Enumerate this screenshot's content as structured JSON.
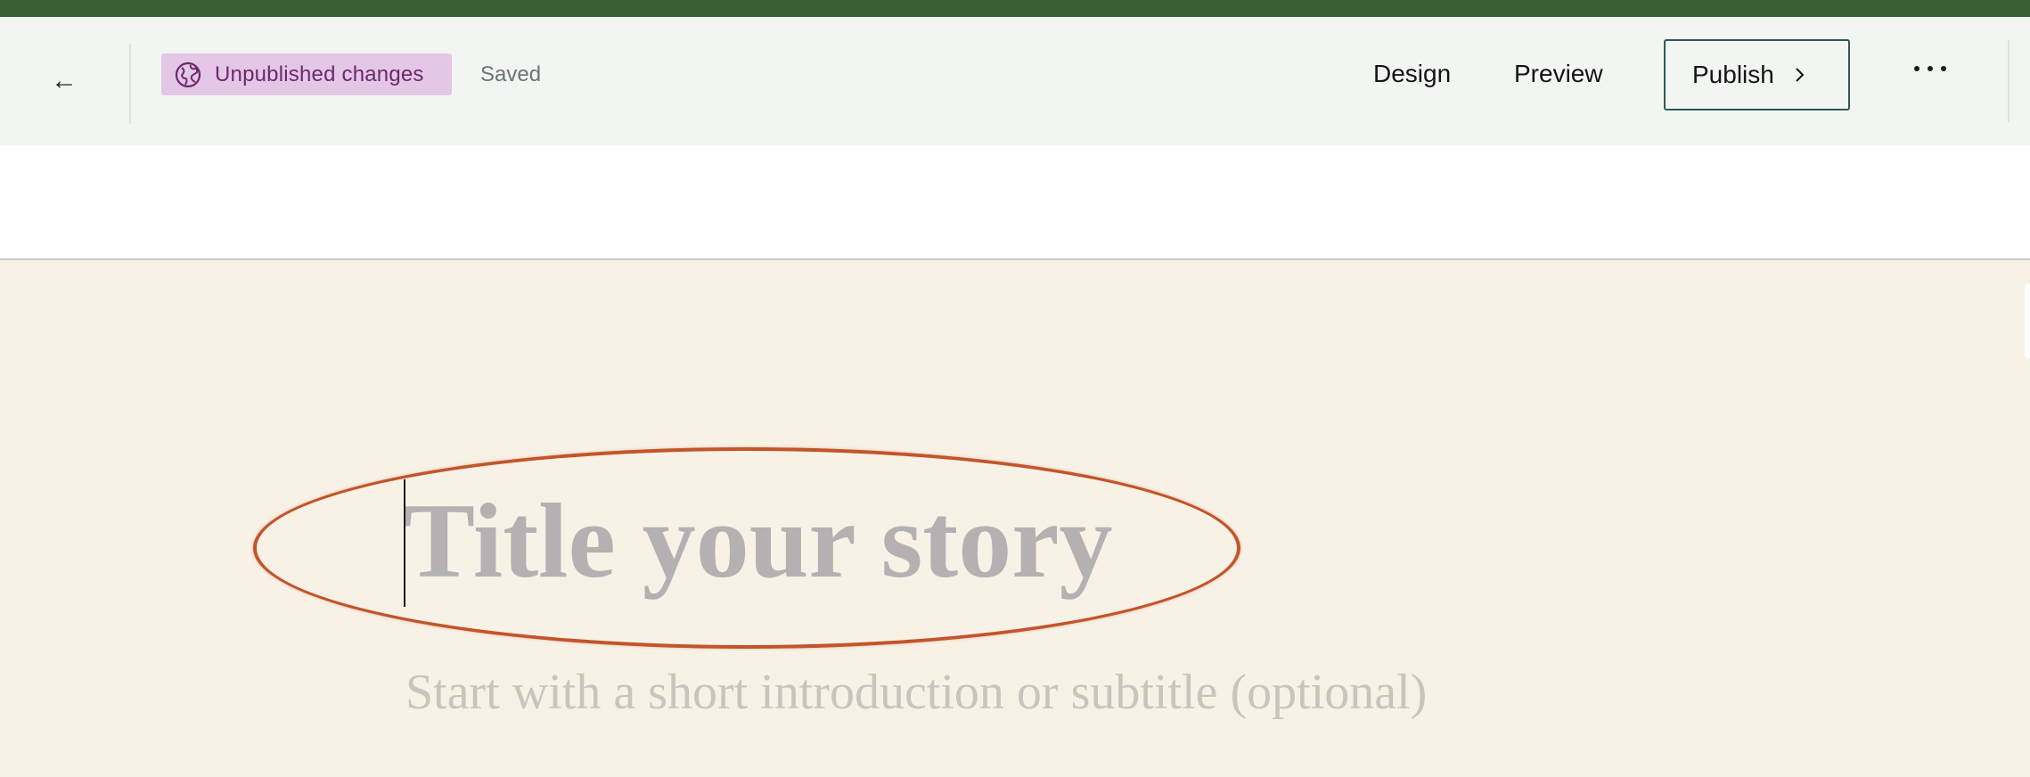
{
  "header": {
    "back_icon": "arrow-left-icon",
    "status_badge": {
      "icon": "globe-icon",
      "label": "Unpublished changes"
    },
    "save_status": "Saved",
    "nav": [
      {
        "label": "Design"
      },
      {
        "label": "Preview"
      }
    ],
    "publish_label": "Publish",
    "more_icon": "more-horizontal-icon"
  },
  "editor": {
    "title_placeholder": "Title your story",
    "subtitle_placeholder": "Start with a short introduction or subtitle (optional)"
  },
  "colors": {
    "top_strip": "#3a5f35",
    "canvas_bg": "#f8f1e6",
    "badge_bg": "#e4c6e6",
    "badge_text": "#6a2a6c",
    "publish_border": "#2e5a59",
    "annotation_ellipse": "#c2552a"
  }
}
